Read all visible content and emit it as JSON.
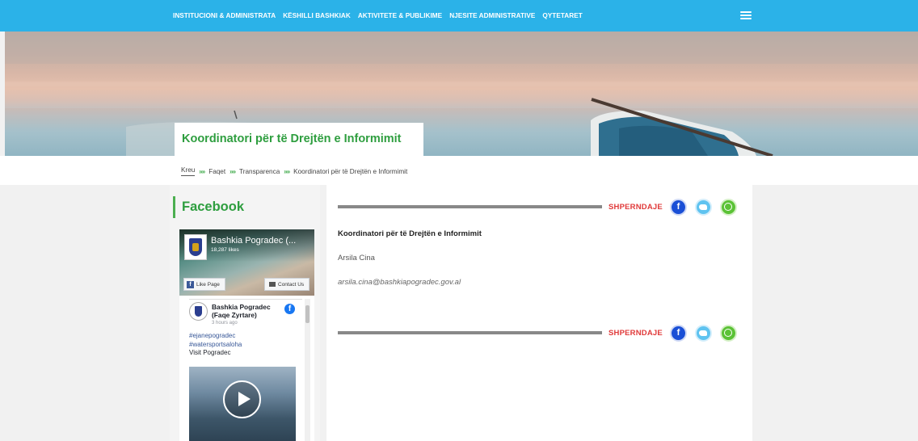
{
  "nav": {
    "items": [
      {
        "label": "INSTITUCIONI & ADMINISTRATA"
      },
      {
        "label": "KËSHILLI BASHKIAK"
      },
      {
        "label": "AKTIVITETE & PUBLIKIME"
      },
      {
        "label": "NJESITE ADMINISTRATIVE"
      },
      {
        "label": "QYTETARET"
      }
    ],
    "menu_icon": "hamburger-icon"
  },
  "hero": {
    "title": "Koordinatori për të Drejtën e Informimit"
  },
  "breadcrumb": {
    "home": "Kreu",
    "items": [
      "Faqet",
      "Transparenca",
      "Koordinatori për të Drejtën e Informimit"
    ],
    "separator": "»»"
  },
  "sidebar": {
    "heading": "Facebook",
    "widget": {
      "page_name": "Bashkia Pogradec (...",
      "likes": "18,287 likes",
      "like_button": "Like Page",
      "contact_button": "Contact Us",
      "post": {
        "author": "Bashkia Pogradec (Faqe Zyrtare)",
        "time": "3 hours ago",
        "lines": [
          "#ejanepogradec",
          "#watersportsaloha",
          "Visit Pogradec"
        ]
      }
    }
  },
  "main": {
    "share_label": "SHPERNDAJE",
    "title": "Koordinatori për të Drejtën e Informimit",
    "person": "Arsila Cina",
    "email": "arsila.cina@bashkiapogradec.gov.al"
  },
  "colors": {
    "nav_bg": "#2bb2e8",
    "green": "#2e9e3f",
    "share_red": "#e03a3a",
    "facebook_blue": "#1a4fd6",
    "twitter_blue": "#5fc3f0",
    "whatsapp_green": "#5bc236"
  }
}
